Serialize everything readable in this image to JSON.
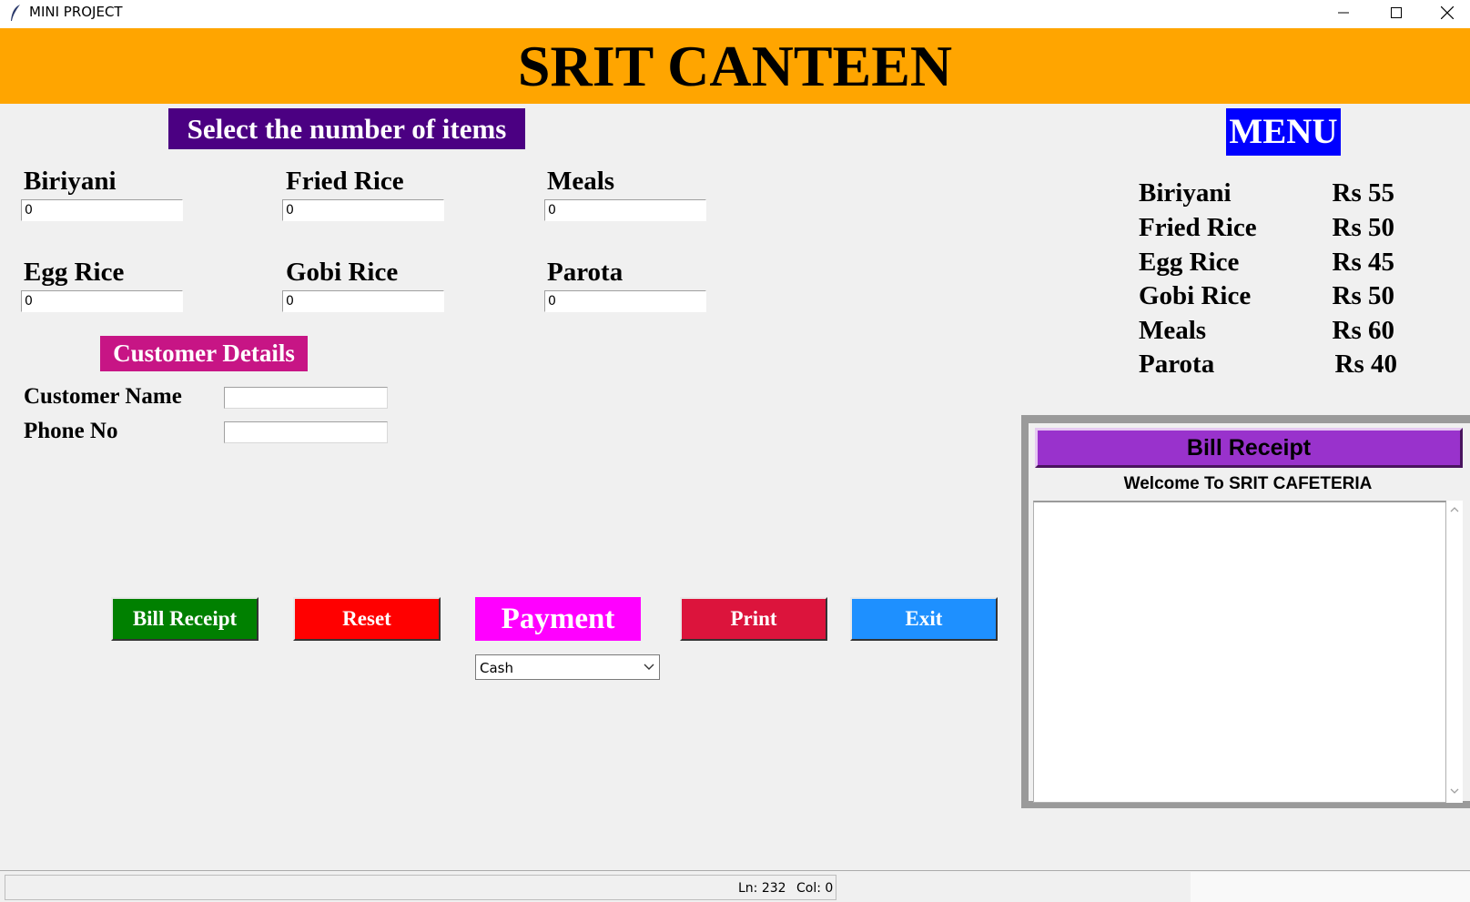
{
  "window": {
    "title": "MINI PROJECT"
  },
  "header": {
    "title": "SRIT CANTEEN"
  },
  "order": {
    "heading": "Select the number of items",
    "items": [
      {
        "label": "Biriyani",
        "value": "0"
      },
      {
        "label": "Fried Rice",
        "value": "0"
      },
      {
        "label": "Meals",
        "value": "0"
      },
      {
        "label": "Egg Rice",
        "value": "0"
      },
      {
        "label": "Gobi Rice",
        "value": "0"
      },
      {
        "label": "Parota",
        "value": "0"
      }
    ]
  },
  "customer": {
    "heading": "Customer Details",
    "name_label": "Customer Name",
    "name_value": "",
    "phone_label": "Phone No",
    "phone_value": ""
  },
  "menu": {
    "heading": "MENU",
    "items": [
      {
        "name": "Biriyani",
        "price": "Rs 55"
      },
      {
        "name": "Fried Rice",
        "price": "Rs 50"
      },
      {
        "name": "Egg Rice",
        "price": "Rs 45"
      },
      {
        "name": "Gobi Rice",
        "price": "Rs 50"
      },
      {
        "name": "Meals",
        "price": "Rs 60"
      },
      {
        "name": "Parota",
        "price": "Rs 40"
      }
    ]
  },
  "buttons": {
    "bill_receipt": "Bill Receipt",
    "reset": "Reset",
    "payment": "Payment",
    "print": "Print",
    "exit": "Exit"
  },
  "payment": {
    "selected": "Cash"
  },
  "receipt": {
    "title": "Bill Receipt",
    "welcome": "Welcome To SRIT CAFETERIA",
    "text": ""
  },
  "statusbar": {
    "line": "Ln: 232",
    "col": "Col: 0"
  },
  "colors": {
    "banner": "#ffa500",
    "select_heading": "#4b0082",
    "customer_heading": "#c71585",
    "menu_heading": "#0000ff",
    "bill_button": "#008000",
    "reset_button": "#ff0000",
    "payment_label": "#ff00ff",
    "print_button": "#dc143c",
    "exit_button": "#1e90ff",
    "receipt_title": "#9932cc"
  },
  "icons": {
    "app": "feather-icon",
    "minimize": "minimize-icon",
    "maximize": "maximize-icon",
    "close": "close-icon",
    "dropdown": "chevron-down-icon"
  }
}
